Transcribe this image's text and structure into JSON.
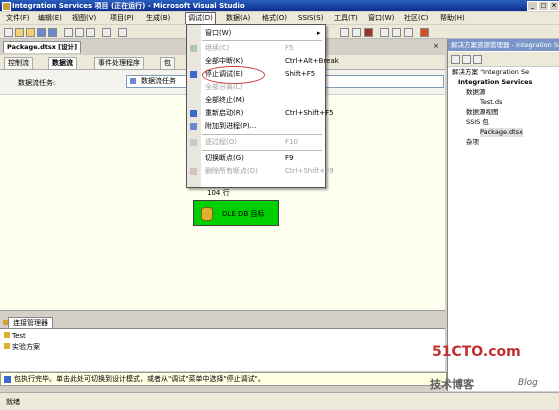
{
  "window": {
    "title": "Integration Services 项目 (正在运行) - Microsoft Visual Studio"
  },
  "menubar": [
    {
      "label": "文件(F)"
    },
    {
      "label": "编辑(E)"
    },
    {
      "label": "视图(V)"
    },
    {
      "label": "项目(P)"
    },
    {
      "label": "生成(B)"
    },
    {
      "label": "调试(D)"
    },
    {
      "label": "数据(A)"
    },
    {
      "label": "格式(O)"
    },
    {
      "label": "SSIS(S)"
    },
    {
      "label": "工具(T)"
    },
    {
      "label": "窗口(W)"
    },
    {
      "label": "社区(C)"
    },
    {
      "label": "帮助(H)"
    }
  ],
  "doc_tab": {
    "label": "Package.dtsx [设计]"
  },
  "designer_tabs": [
    {
      "label": "控制流"
    },
    {
      "label": "数据流"
    },
    {
      "label": "事件处理程序"
    },
    {
      "label": "包"
    }
  ],
  "task_row": {
    "label": "数据流任务:",
    "value": "数据流任务"
  },
  "canvas": {
    "rows_label": "104 行",
    "task_label": "OLE DB 目标"
  },
  "debug_menu": [
    {
      "label": "窗口(W)",
      "shortcut": "",
      "submenu": true,
      "disabled": false
    },
    {
      "sep": true
    },
    {
      "label": "继续(C)",
      "shortcut": "F5",
      "disabled": true
    },
    {
      "label": "全部中断(K)",
      "shortcut": "Ctrl+Alt+Break",
      "disabled": false
    },
    {
      "label": "停止调试(E)",
      "shortcut": "Shift+F5",
      "disabled": false,
      "circled": true
    },
    {
      "label": "全部分离(L)",
      "shortcut": "",
      "disabled": true
    },
    {
      "label": "全部终止(M)",
      "shortcut": "",
      "disabled": false
    },
    {
      "label": "重新启动(R)",
      "shortcut": "Ctrl+Shift+F5",
      "disabled": false
    },
    {
      "label": "附加到进程(P)...",
      "shortcut": "",
      "disabled": false
    },
    {
      "sep": true
    },
    {
      "label": "逐过程(O)",
      "shortcut": "F10",
      "disabled": true
    },
    {
      "sep": true
    },
    {
      "label": "切换断点(G)",
      "shortcut": "F9",
      "disabled": false
    },
    {
      "label": "删除所有断点(D)",
      "shortcut": "Ctrl+Shift+F9",
      "disabled": true
    }
  ],
  "solution_explorer": {
    "title": "解决方案资源管理器 - Integration Services 项目",
    "nodes": [
      {
        "label": "解决方案 \"Integration Se",
        "indent": 0
      },
      {
        "label": "Integration Services",
        "indent": 1
      },
      {
        "label": "数据源",
        "indent": 2
      },
      {
        "label": "Test.ds",
        "indent": 3
      },
      {
        "label": "数据源视图",
        "indent": 2
      },
      {
        "label": "SSIS 包",
        "indent": 2
      },
      {
        "label": "Package.dtsx",
        "indent": 3
      },
      {
        "label": "杂项",
        "indent": 2
      }
    ]
  },
  "connections": {
    "tab_label": "连接管理器",
    "items": [
      {
        "label": "Test"
      },
      {
        "label": "实验方案"
      }
    ]
  },
  "status_strip": {
    "text": "包执行完毕。单击此处可切换到设计模式，或者从\"调试\"菜单中选择\"停止调试\"。"
  },
  "statusbar": {
    "text": "就绪"
  },
  "watermark": {
    "line1": "51CTO.com",
    "line2": "技术博客",
    "line3": "Blog"
  },
  "colors": {
    "title": "#0a2f8f",
    "task": "#00d000",
    "circle": "#d04040"
  }
}
